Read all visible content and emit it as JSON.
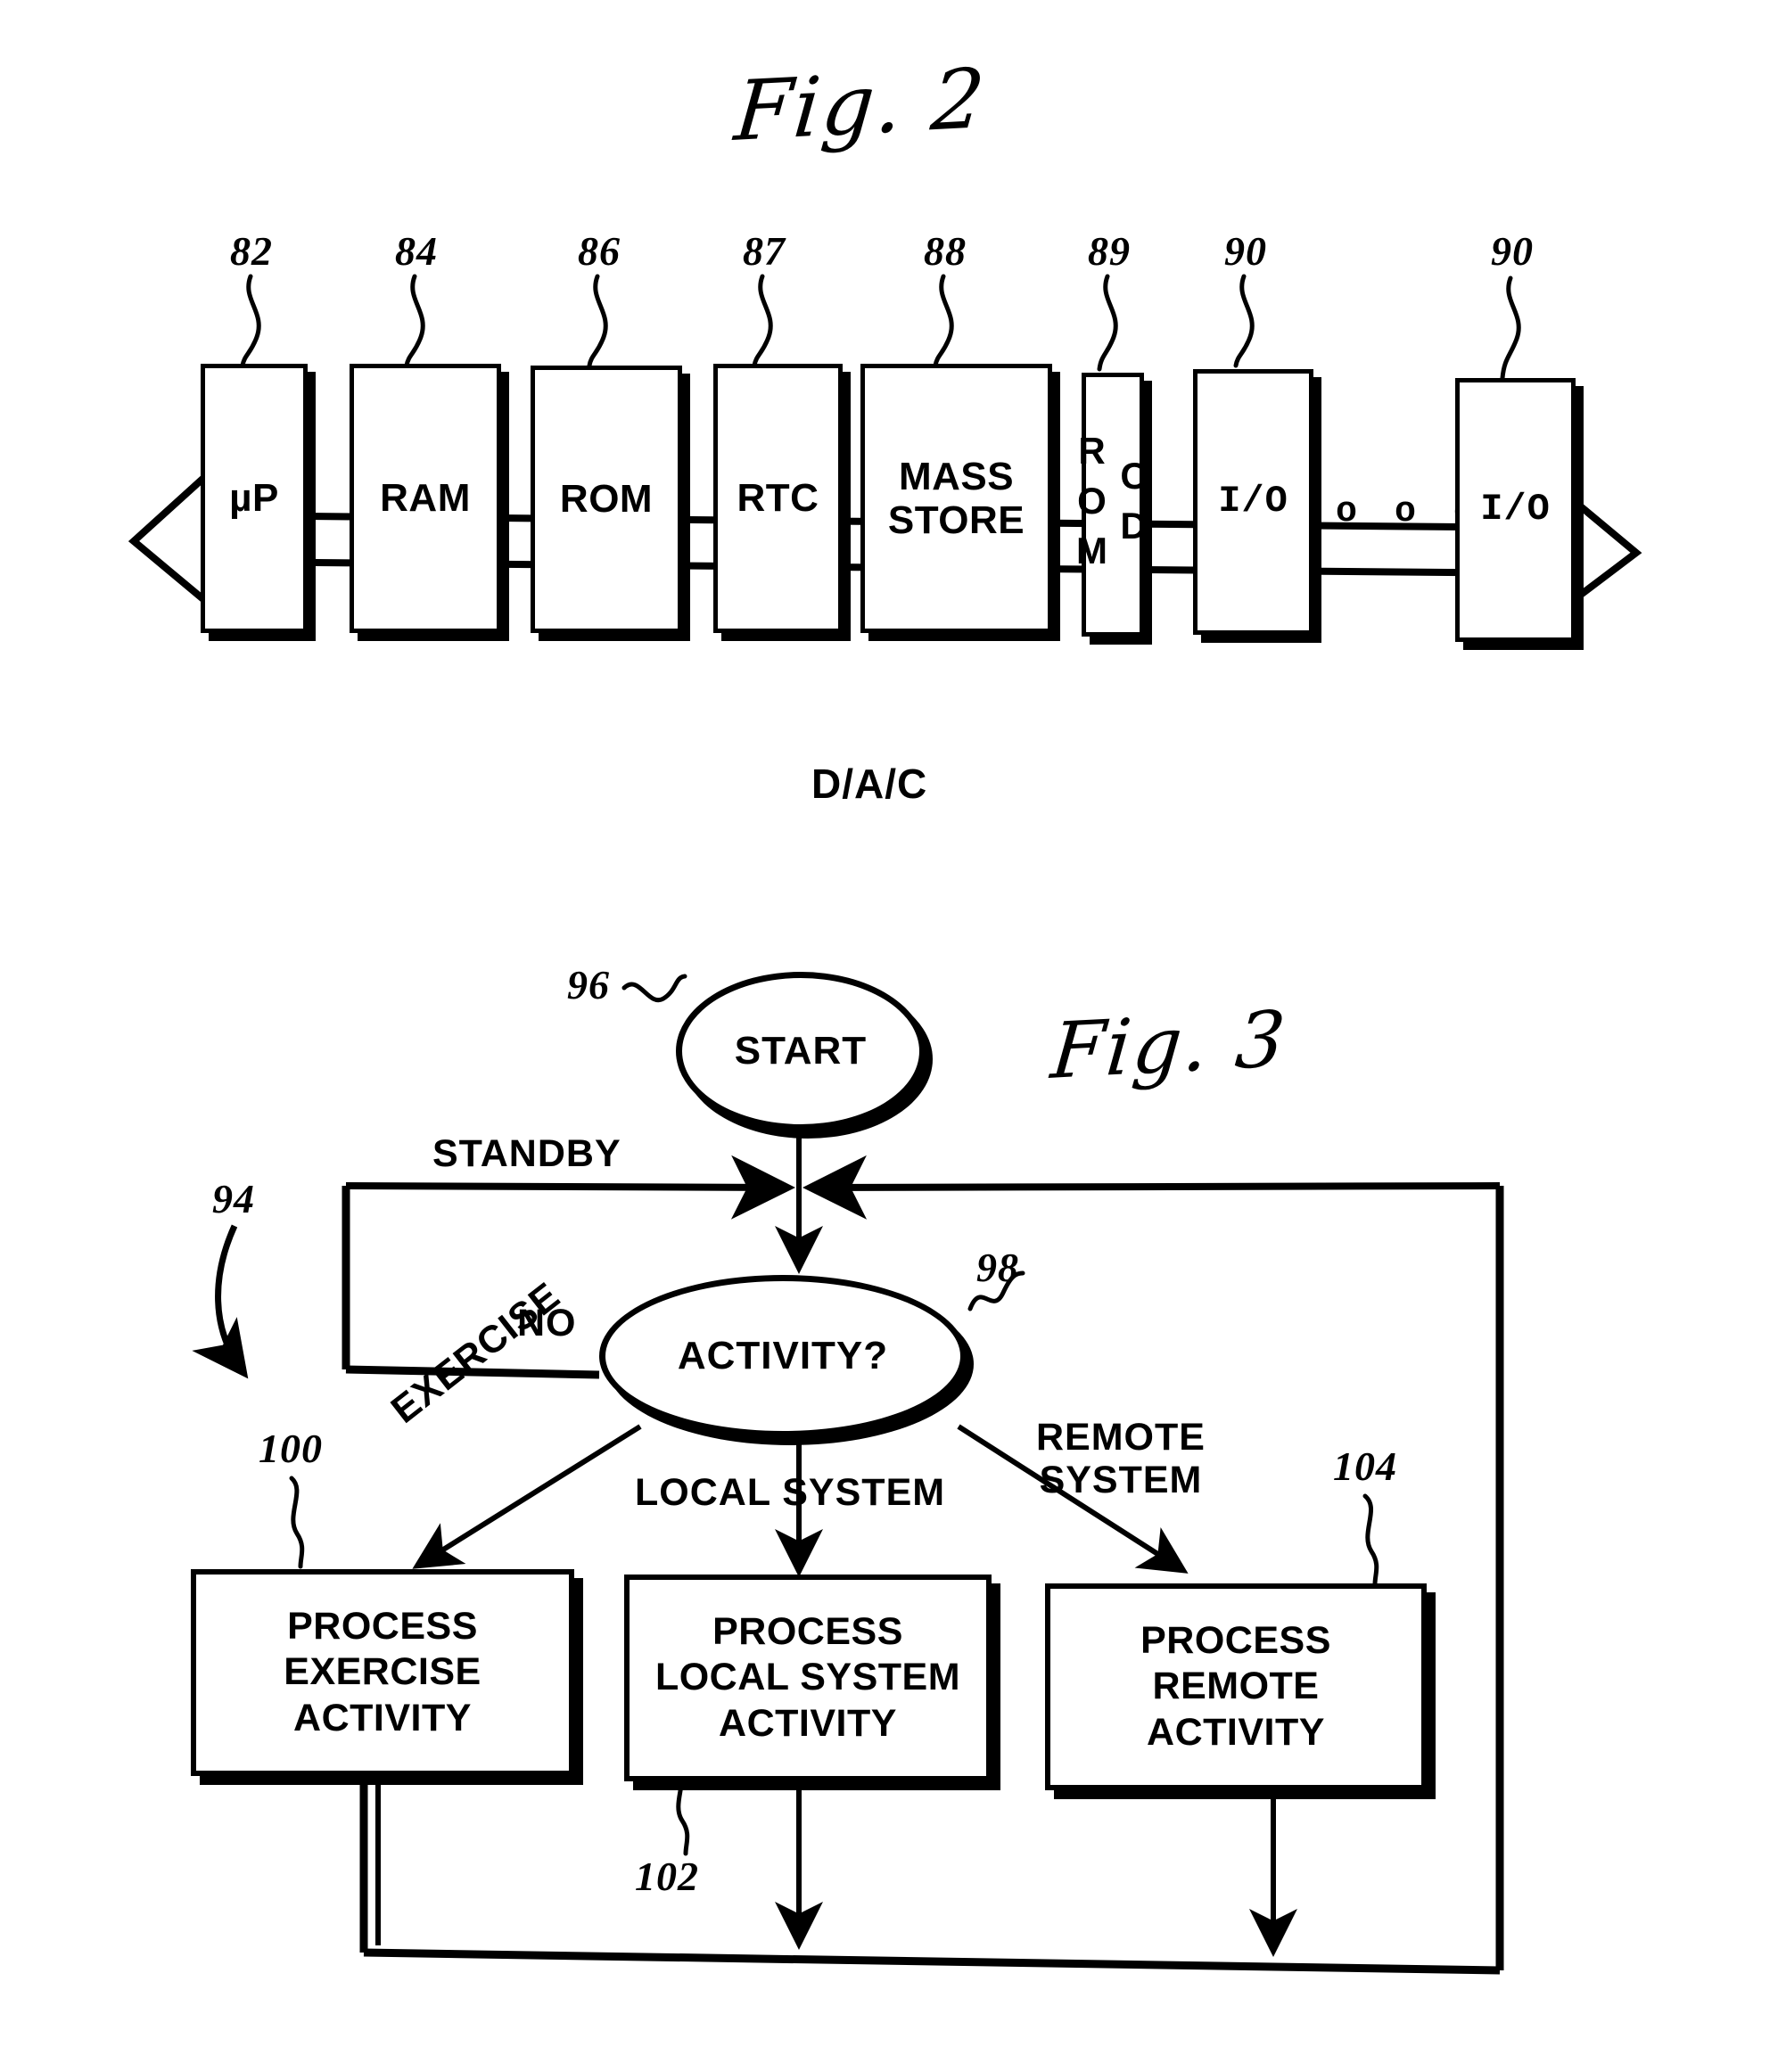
{
  "document": {
    "kind": "patent-drawing-sheet",
    "figures": [
      "Fig. 2",
      "Fig. 3"
    ]
  },
  "fig2": {
    "title": "Fig. 2",
    "bus": {
      "label": "D/A/C",
      "name": "data-address-control-bus"
    },
    "ellipsis": "o o o",
    "components": [
      {
        "ref": "82",
        "label": "µP",
        "style": "sans"
      },
      {
        "ref": "84",
        "label": "RAM",
        "style": "sans"
      },
      {
        "ref": "86",
        "label": "ROM",
        "style": "sans"
      },
      {
        "ref": "87",
        "label": "RTC",
        "style": "sans"
      },
      {
        "ref": "88",
        "label": "MASS\nSTORE",
        "style": "sans"
      },
      {
        "ref": "89",
        "label": "CD ROM",
        "style": "vertical"
      },
      {
        "ref": "90",
        "label": "I/O",
        "style": "mono"
      },
      {
        "ref": "90",
        "label": "I/O",
        "style": "mono"
      }
    ]
  },
  "fig3": {
    "title": "Fig. 3",
    "flowchart_ref": "94",
    "nodes": [
      {
        "ref": "96",
        "label": "START",
        "shape": "oval"
      },
      {
        "ref": "98",
        "label": "ACTIVITY?",
        "shape": "oval"
      },
      {
        "ref": "100",
        "label": "PROCESS\nEXERCISE\nACTIVITY",
        "shape": "rect"
      },
      {
        "ref": "102",
        "label": "PROCESS\nLOCAL SYSTEM\nACTIVITY",
        "shape": "rect"
      },
      {
        "ref": "104",
        "label": "PROCESS\nREMOTE\nACTIVITY",
        "shape": "rect"
      }
    ],
    "edge_labels": {
      "standby": "STANDBY",
      "no": "NO",
      "exercise": "EXERCISE",
      "local_system": "LOCAL  SYSTEM",
      "remote_system": "REMOTE\nSYSTEM"
    }
  }
}
